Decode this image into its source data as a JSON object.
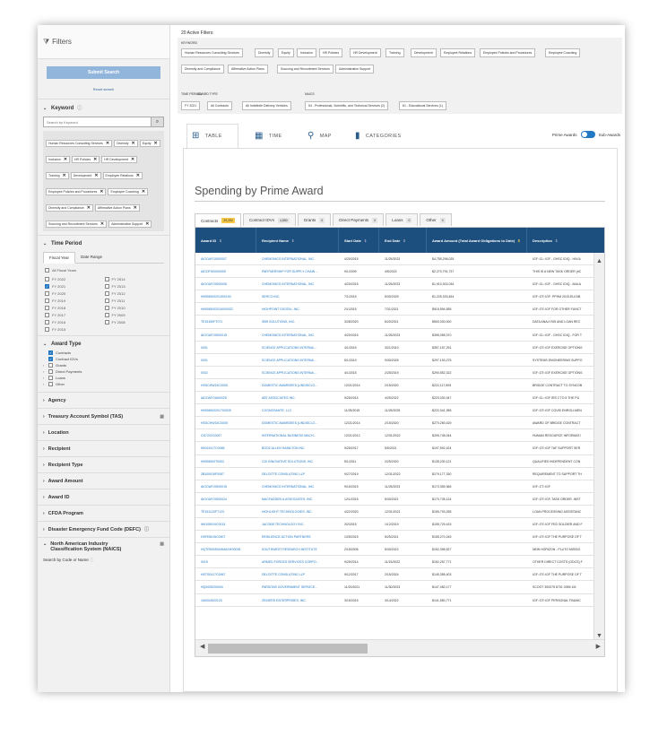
{
  "sidebar": {
    "title": "Filters",
    "submit_label": "Submit Search",
    "reset_label": "Reset search",
    "keyword": {
      "title": "Keyword",
      "placeholder": "Search by Keyword",
      "chips": [
        "Human Resources Consulting Services",
        "Diversity",
        "Equity",
        "Inclusion",
        "HR Policies",
        "HR Development",
        "Training",
        "Development",
        "Employee Relations",
        "Employee Policies and Procedures",
        "Employee Coaching",
        "Diversity and Compliance",
        "Affirmative Action Plans",
        "Sourcing and Recruitment Services",
        "Administrative Support"
      ]
    },
    "time_period": {
      "title": "Time Period",
      "tabs": [
        "Fiscal Year",
        "Date Range"
      ],
      "all_label": "All Fiscal Years",
      "years": [
        "FY 2022",
        "FY 2014",
        "FY 2021",
        "FY 2013",
        "FY 2020",
        "FY 2012",
        "FY 2019",
        "FY 2011",
        "FY 2018",
        "FY 2010",
        "FY 2017",
        "FY 2009",
        "FY 2016",
        "FY 2008",
        "FY 2015",
        ""
      ],
      "checked_index": 2
    },
    "award_type": {
      "title": "Award Type",
      "items": [
        {
          "label": "Contracts",
          "checked": true,
          "arrow": ""
        },
        {
          "label": "Contract IDVs",
          "checked": true,
          "arrow": ""
        },
        {
          "label": "Grants",
          "checked": false,
          "arrow": "›"
        },
        {
          "label": "Direct Payments",
          "checked": false,
          "arrow": "›"
        },
        {
          "label": "Loans",
          "checked": false,
          "arrow": "›"
        },
        {
          "label": "Other",
          "checked": false,
          "arrow": "›"
        }
      ]
    },
    "collapsed_sections": [
      "Agency",
      "Treasury Account Symbol (TAS)",
      "Location",
      "Recipient",
      "Recipient Type",
      "Award Amount",
      "Award ID",
      "CFDA Program",
      "Disaster Emergency Fund Code (DEFC)"
    ],
    "naics_title": "North American Industry Classification System (NAICS)",
    "search_code_label": "Search by Code or Name"
  },
  "main": {
    "active_filters_label": "20 Active Filters:",
    "keyword_label": "KEYWORD",
    "keyword_chips": [
      "Human Resources Consulting Services",
      "Diversity",
      "Equity",
      "Inclusion",
      "HR Policies",
      "HR Development",
      "Training",
      "Development",
      "Employee Relations",
      "Employee Policies and Procedures",
      "Employee Coaching",
      "Diversity and Compliance",
      "Affirmative Action Plans",
      "Sourcing and Recruitment Services",
      "Administrative Support"
    ],
    "time_label": "TIME PERIOD",
    "award_type_label": "AWARD TYPE",
    "naics_label": "NAICS",
    "time_chip": "FY 2021",
    "award_chips": [
      "All Contracts",
      "All Indefinite Delivery Vehicles"
    ],
    "naics_chips": [
      "54 - Professional, Scientific, and Technical Services (2)",
      "61 - Educational Services (1)"
    ],
    "view_tabs": [
      {
        "label": "TABLE",
        "icon": "table-icon"
      },
      {
        "label": "TIME",
        "icon": "calendar-icon"
      },
      {
        "label": "MAP",
        "icon": "map-pin-icon"
      },
      {
        "label": "CATEGORIES",
        "icon": "bar-chart-icon"
      }
    ],
    "toggle_left": "Prime Awards",
    "toggle_right": "Sub-Awards",
    "title": "Spending by Prime Award",
    "award_tabs": [
      {
        "label": "Contracts",
        "count": "29,252"
      },
      {
        "label": "Contract IDVs",
        "count": "4,850"
      },
      {
        "label": "Grants",
        "count": "0"
      },
      {
        "label": "Direct Payments",
        "count": "0"
      },
      {
        "label": "Loans",
        "count": "0"
      },
      {
        "label": "Other",
        "count": "0"
      }
    ],
    "columns": [
      "Award ID",
      "Recipient Name",
      "Start Date",
      "End Date",
      "Award Amount (Total Award Obligations to Date)",
      "Description"
    ],
    "rows": [
      [
        "AIOOAFOIS00007",
        "CHEMONICS INTERNATIONAL, INC.",
        "4/20/2015",
        "11/25/2023",
        "$4,755,296,025",
        "IGF::CL::IGF - GHSC IDIQ - HIV/A"
      ],
      [
        "AIDOFSI000000S",
        "PARTNERSHIP FOR SUPPLY CHAIN ...",
        "9/1/2009",
        "4/5/2022",
        "$2,270,791,737",
        "THIS IS A NEW TASK ORDER (#C"
      ],
      [
        "AIOOAFOIS00006",
        "CHEMONICS INTERNATIONAL, INC.",
        "4/20/2015",
        "11/25/2023",
        "$1,910,302,034",
        "IGF::CL::IGF - GHSC IDIQ - MALA"
      ],
      [
        "HHSM500201500190",
        "SERCO INC.",
        "7/1/2015",
        "5/30/2025",
        "$1,225,333,454",
        "IGF::OT::IGF: PPHM 2015-ELIGIB"
      ],
      [
        "HHSM500201600002C",
        "HIGHPOINT DIGITAL, INC.",
        "2/1/2015",
        "7/31/2021",
        "$915,594,555",
        "IGF::OT::IGF FOR OTHER FUNCT"
      ],
      [
        "TE15150FT071",
        "SBR SOLUTIONS, INC.",
        "3/28/2020",
        "6/20/2021",
        "$500,000,000",
        "DATA ANALYSIS AND LOAN REC"
      ],
      [
        "AIOOAFOIS00015",
        "CHEMONICS INTERNATIONAL, INC.",
        "4/20/2015",
        "11/25/2023",
        "$395,055,370",
        "IGF::CL::IGF - GHSC IDIQ - FOR T"
      ],
      [
        "0001",
        "SCIENCE APPLICATIONS INTERNA...",
        "4/1/2015",
        "3/21/2019",
        "$357,157,291",
        "IGF::OT::IGF EXERCISE OPTIONS"
      ],
      [
        "0001",
        "SCIENCE APPLICATIONS INTERNA...",
        "5/1/2019",
        "9/30/2025",
        "$297,153,275",
        "SYSTEMS ENGINEERING SUPPO"
      ],
      [
        "0002",
        "SCIENCE APPLICATIONS INTERNA...",
        "4/1/2015",
        "2/25/2019",
        "$290,552,322",
        "IGF::OT::IGF EXERCISE OPTIONS"
      ],
      [
        "HSSCHW15C0005",
        "DOMESTIC AWARDEES (UNDISCLO...",
        "12/21/2014",
        "2/15/2020",
        "$222,117,509",
        "BRIDGE CONTRACT TO SYNCOB"
      ],
      [
        "AIDOAFOIA00025",
        "ABT ASSOCIATES INC.",
        "9/25/2014",
        "4/25/2022",
        "$223,030,347",
        "IGF::CL::IGF IRS 2 TO 5 THE PU"
      ],
      [
        "HHSM500201700025",
        "COGNOSANTE, LLC",
        "11/25/2015",
        "11/25/2025",
        "$222,041,355",
        "IGF::OT::IGF COVID ENROLLMEN"
      ],
      [
        "HSSCHW15C0005",
        "DOMESTIC AWARDEES (UNDISCLO...",
        "12/21/2014",
        "2/15/2020",
        "$270,250,429",
        "AWARD OF BRIDGE CONTRACT"
      ],
      [
        "GS7202C0007",
        "INTERNATIONAL BUSINESS MACH...",
        "12/21/2012",
        "12/31/2022",
        "$205,745,044",
        "HUMAN RESOURCE INFORMATI"
      ],
      [
        "N0019417C0065",
        "BOOZ ALLEN HAMILTON INC.",
        "9/25/2017",
        "5/5/2021",
        "$197,592,424",
        "IGF::OT::IGF TAF SUPPORT SER"
      ],
      [
        "HHSM500T0002",
        "CGI INNOVATIVE SOLUTIONS, INC.",
        "5/1/2011",
        "2/25/2020",
        "$135,230,121",
        "QUALIFIED INDEPENDENT CON"
      ],
      [
        "2B100519F0057",
        "DELOITTE CONSULTING LLP",
        "9/27/2019",
        "12/31/2022",
        "$179,177,330",
        "REQUIREMENT TO SUPPORT TH"
      ],
      [
        "AIOOAFOIS00015",
        "CHEMONICS INTERNATIONAL, INC.",
        "9/15/2015",
        "11/25/2023",
        "$173,359,365",
        "IGF::CT::IGF"
      ],
      [
        "AIOOAFOIS00024",
        "MACFADDEN & ASSOCIATES, INC.",
        "12/1/2015",
        "5/30/2021",
        "$170,735,124",
        "IGF::OT::IGF-TASK ORDER, INST"
      ],
      [
        "TE151120FT123",
        "HIGHLIGHT TECHNOLOGIES, INC.",
        "4/22/2020",
        "12/31/2021",
        "$155,793,255",
        "LOAN PROCESSING ASSISTANC"
      ],
      [
        "W9105019C0013",
        "JACOBS TECHNOLOGY INC.",
        "3/2/2015",
        "1/12/2019",
        "$155,729,415",
        "IGF::OT::IGF FED SOLDIER AND F"
      ],
      [
        "HSFE6015C0007",
        "RESILIENCE ACTION PARTNERS",
        "1/25/2015",
        "5/25/2021",
        "$155,270,245",
        "IGF::OT::IGF THE PURPOSE OF T"
      ],
      [
        "HQTR500504HMASHS0035",
        "SOUTHWEST RESEARCH INSTITUTE",
        "2/15/2005",
        "5/30/2022",
        "$152,395,527",
        "NEW HORIZON - PLUTO MISSIO"
      ],
      [
        "0015",
        "ARMED FORCES SERVICES CORPO...",
        "9/25/2014",
        "11/15/2022",
        "$152,257,771",
        "OTHER DIRECT COSTS (ODCS) F"
      ],
      [
        "HSTS0417C0067",
        "DELOITTE CONSULTING LLP",
        "9/12/2017",
        "2/15/2024",
        "$145,355,403",
        "IGF::OT::IGF THE PURPOSE OF T"
      ],
      [
        "HQ0005200004",
        "PARSONS GOVERNMENT SERVICE...",
        "11/20/2021",
        "11/30/2023",
        "$147,450,177",
        "SCOOT 300075 8701 0055 1M"
      ],
      [
        "1A0004520123",
        "ZEIDERS ENTERPRISES, INC.",
        "3/15/2015",
        "3/14/2022",
        "$141,550,771",
        "IGF::OT::IGF PERSONAL FINANC"
      ]
    ]
  }
}
